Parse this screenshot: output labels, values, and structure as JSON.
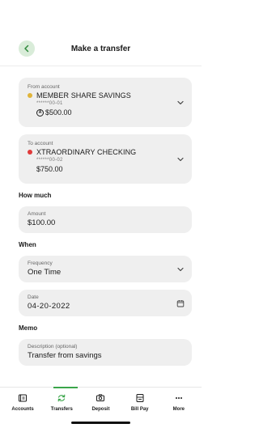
{
  "header": {
    "title": "Make a transfer"
  },
  "from_account": {
    "label": "From account",
    "name": "MEMBER SHARE SAVINGS",
    "number": "******00-01",
    "balance": "$500.00",
    "dot_color": "#e0b43a"
  },
  "to_account": {
    "label": "To account",
    "name": "XTRAORDINARY CHECKING",
    "number": "******00-02",
    "balance": "$750.00",
    "dot_color": "#e03a3a"
  },
  "how_much": {
    "heading": "How much",
    "amount_label": "Amount",
    "amount_value": "$100.00"
  },
  "when": {
    "heading": "When",
    "frequency_label": "Frequency",
    "frequency_value": "One Time",
    "date_label": "Date",
    "date_value": "04-20-2022"
  },
  "memo": {
    "heading": "Memo",
    "description_label": "Description (optional)",
    "description_value": "Transfer from savings"
  },
  "tab_bar": {
    "accent_color": "#3aa54a",
    "tabs": [
      {
        "label": "Accounts",
        "icon": "accounts-icon"
      },
      {
        "label": "Transfers",
        "icon": "transfers-icon",
        "active": true
      },
      {
        "label": "Deposit",
        "icon": "camera-icon"
      },
      {
        "label": "Bill Pay",
        "icon": "bill-pay-icon"
      },
      {
        "label": "More",
        "icon": "more-icon"
      }
    ]
  }
}
